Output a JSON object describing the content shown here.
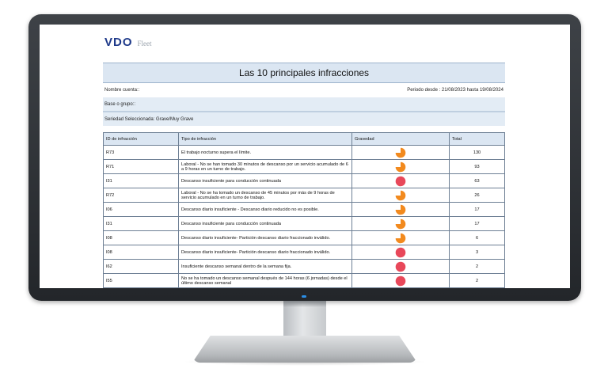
{
  "brand": {
    "logo": "VDO",
    "product": "Fleet"
  },
  "report": {
    "title": "Las 10 principales infracciones",
    "account_label": "Nombre cuenta::",
    "period": "Periodo desde : 21/08/2023 hasta 19/08/2024",
    "group_label": "Base o grupo::",
    "severity_selected": "Seriedad Seleccionada: Grave/Muy Grave"
  },
  "table": {
    "headers": [
      "ID de infracción",
      "Tipo de infracción",
      "Gravedad",
      "Total"
    ],
    "rows": [
      {
        "id": "R73",
        "type": "El trabajo nocturno supera el límite.",
        "severity": "grave",
        "total": "130"
      },
      {
        "id": "R71",
        "type": "Laboral - No se han tomado 30 minutos de descanso por un servicio acumulado de 6 a 9 horas en un turno de trabajo.",
        "severity": "grave",
        "total": "93"
      },
      {
        "id": "I31",
        "type": "Descanso insuficiente para conducción continuada",
        "severity": "muy-grave",
        "total": "63"
      },
      {
        "id": "R72",
        "type": "Laboral - No se ha tomado un descanso de 45 minutos por más de 9 horas de servicio acumulado en un turno de trabajo.",
        "severity": "grave",
        "total": "26"
      },
      {
        "id": "I06",
        "type": "Descanso diario insuficiente - Descanso diario reducido no es posible.",
        "severity": "grave",
        "total": "17"
      },
      {
        "id": "I31",
        "type": "Descanso insuficiente para conducción continuada",
        "severity": "grave",
        "total": "17"
      },
      {
        "id": "I08",
        "type": "Descanso diario insuficiente- Partición descanso diario fraccionado inválido.",
        "severity": "grave",
        "total": "6"
      },
      {
        "id": "I08",
        "type": "Descanso diario insuficiente- Partición descanso diario fraccionado inválido.",
        "severity": "muy-grave",
        "total": "3"
      },
      {
        "id": "I62",
        "type": "Insuficiente descanso semanal dentro de la semana fija.",
        "severity": "muy-grave",
        "total": "2"
      },
      {
        "id": "I55",
        "type": "No se ha tomado un descanso semanal después de 144 horas (6 jornadas) desde el último descanso semanal",
        "severity": "muy-grave",
        "total": "2"
      }
    ]
  },
  "severity_icons": {
    "grave": {
      "icon": "orange-pie-icon",
      "color": "#f28a1e"
    },
    "muy-grave": {
      "icon": "red-circle-icon",
      "color": "#e8485a"
    }
  },
  "colors": {
    "header_band": "#dbe6f2",
    "logo": "#1f3a8a",
    "led": "#2b8fe8"
  }
}
